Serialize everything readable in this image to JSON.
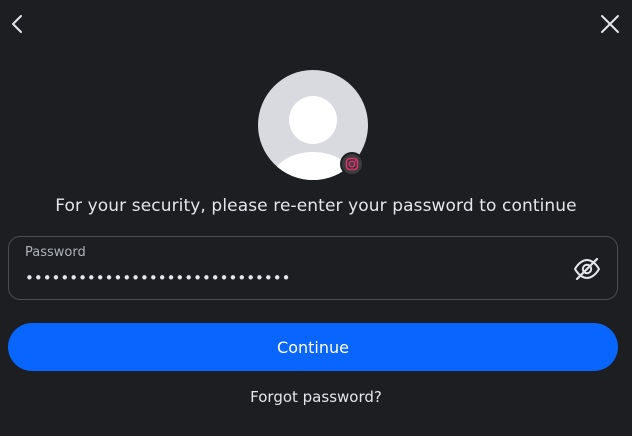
{
  "nav": {
    "back_icon": "chevron-left-icon",
    "close_icon": "close-icon"
  },
  "profile": {
    "avatar_icon": "default-avatar-icon",
    "badge_icon": "instagram-icon",
    "badge_color": "#e1306c"
  },
  "prompt": "For your security, please re-enter your password to continue",
  "password": {
    "label": "Password",
    "value": "••••••••••••••••••••••••••••••",
    "toggle_icon": "eye-off-icon"
  },
  "continue_label": "Continue",
  "forgot_label": "Forgot password?",
  "colors": {
    "background": "#1c1e21",
    "primary": "#0866ff",
    "text": "#e4e6eb",
    "muted": "#b0b3b8",
    "border": "#4a4d52"
  }
}
